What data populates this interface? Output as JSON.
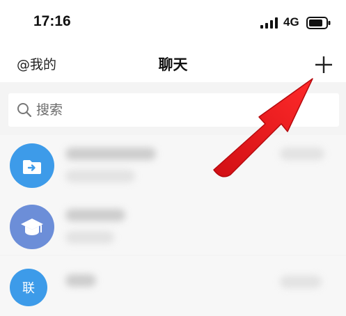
{
  "status_bar": {
    "time": "17:16",
    "network": "4G"
  },
  "nav": {
    "left_label": "@我的",
    "title": "聊天",
    "plus_icon": "plus-icon"
  },
  "search": {
    "placeholder": "搜索"
  },
  "chats": [
    {
      "avatar_icon": "folder-arrow-icon",
      "avatar_color": "#3d9be9"
    },
    {
      "avatar_icon": "graduation-cap-icon",
      "avatar_color": "#6c8ed8"
    },
    {
      "avatar_text": "联",
      "avatar_color": "#3d9be9"
    }
  ],
  "annotation": {
    "arrow_color": "#e8151b"
  }
}
